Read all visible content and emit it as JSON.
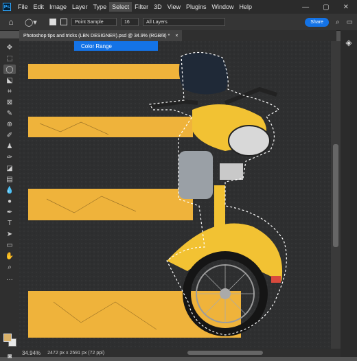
{
  "app": {
    "logo_text": "Ps"
  },
  "menu": [
    "File",
    "Edit",
    "Image",
    "Layer",
    "Type",
    "Select",
    "Filter",
    "3D",
    "View",
    "Plugins",
    "Window",
    "Help"
  ],
  "menu_active": "Select",
  "options": {
    "sample_size": "Point Sample",
    "tolerance": "16",
    "layers_scope": "All Layers",
    "share_label": "Share"
  },
  "document": {
    "tab_title": "Photoshop tips and tricks (LBN DESIGNER).psd @ 34.9% (RGB/8) *",
    "close_glyph": "×"
  },
  "popup": {
    "label": "Color Range"
  },
  "status": {
    "zoom": "34.94%",
    "doc_info": "2472 px x 2591 px (72 ppi)"
  },
  "colors": {
    "accent": "#1473e6",
    "stripe": "#f0b43c",
    "asphalt": "#2f2f2f",
    "bike": "#f2c233"
  },
  "icons": [
    "home-icon",
    "lasso-icon",
    "layers-icon",
    "minimize-icon",
    "maximize-icon",
    "close-icon"
  ]
}
